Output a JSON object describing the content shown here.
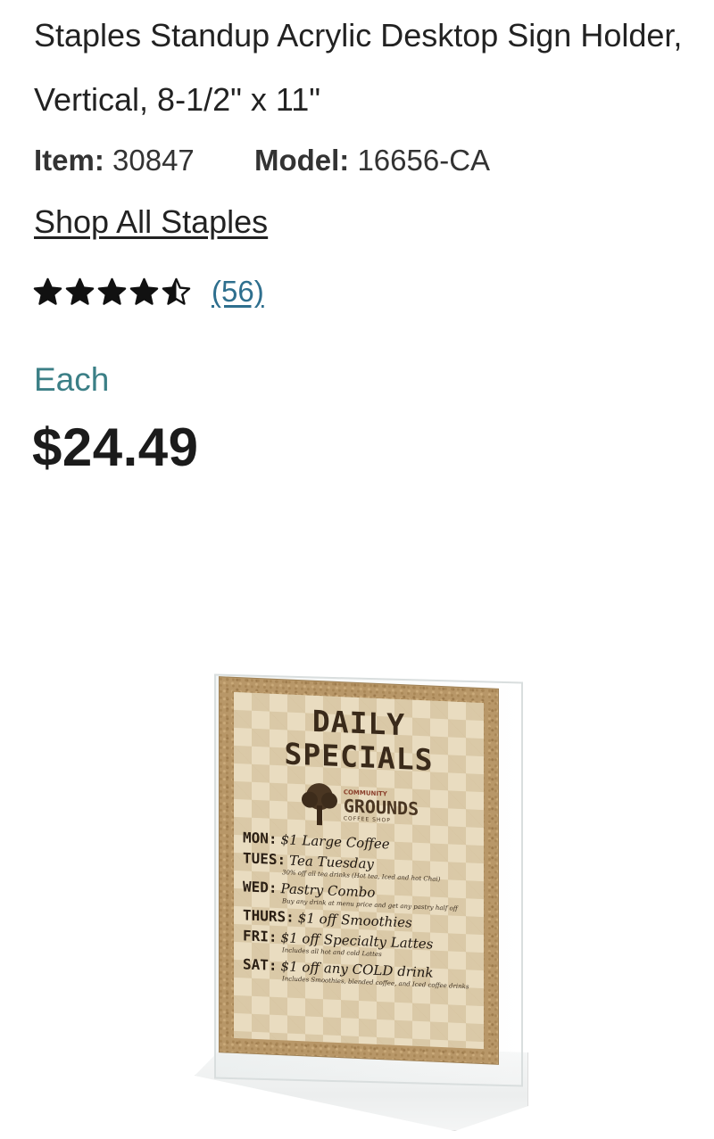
{
  "product": {
    "title": "Staples Standup Acrylic Desktop Sign Holder, Vertical, 8-1/2\" x 11\"",
    "item_label": "Item:",
    "item_number": "30847",
    "model_label": "Model:",
    "model_number": "16656-CA",
    "shop_link": "Shop All Staples",
    "rating": 4.5,
    "rating_max": 5,
    "review_count": "(56)",
    "unit_label": "Each",
    "price": "$24.49"
  },
  "sign_image": {
    "heading": "DAILY SPECIALS",
    "logo_top": "COMMUNITY",
    "logo_main": "GROUNDS",
    "logo_bottom": "COFFEE SHOP",
    "days": [
      {
        "day": "MON:",
        "deal": "$1 Large Coffee",
        "note": ""
      },
      {
        "day": "TUES:",
        "deal": "Tea Tuesday",
        "note": "30% off all tea drinks (Hot tea, Iced and hot Chai)"
      },
      {
        "day": "WED:",
        "deal": "Pastry Combo",
        "note": "Buy any drink at menu price and get any pastry half off"
      },
      {
        "day": "THURS:",
        "deal": "$1 off Smoothies",
        "note": ""
      },
      {
        "day": "FRI:",
        "deal": "$1 off Specialty Lattes",
        "note": "Includes all hot and cold Lattes"
      },
      {
        "day": "SAT:",
        "deal": "$1 off any COLD drink",
        "note": "Includes Smoothies, blended coffee, and Iced coffee drinks"
      }
    ]
  },
  "colors": {
    "accent_teal": "#3b7f86",
    "link_blue": "#2e6f8e",
    "text_dark": "#1b1b1b"
  }
}
